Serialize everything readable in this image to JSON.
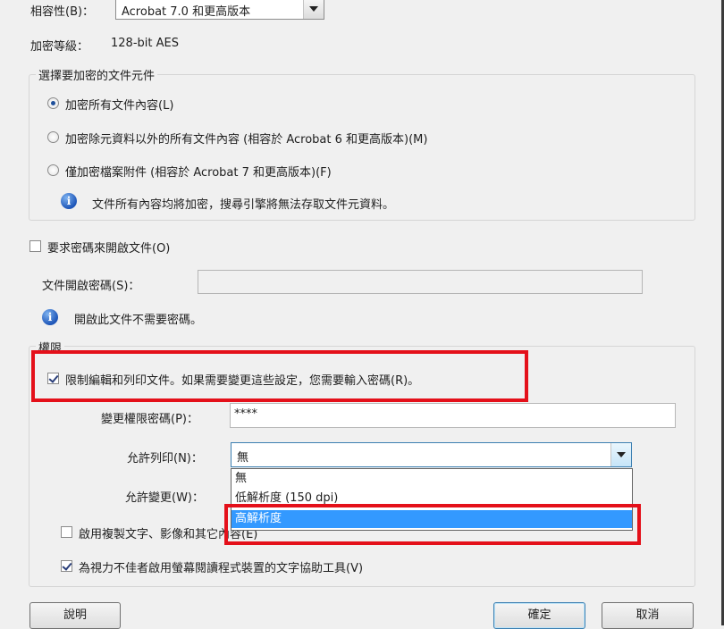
{
  "compatibility": {
    "label": "相容性(B)：",
    "value": "Acrobat 7.0 和更高版本"
  },
  "encryption_level": {
    "label": "加密等級：",
    "value": "128-bit AES"
  },
  "encrypt_group": {
    "legend": "選擇要加密的文件元件",
    "options": [
      {
        "label": "加密所有文件內容(L)",
        "checked": true
      },
      {
        "label": "加密除元資料以外的所有文件內容 (相容於 Acrobat 6 和更高版本)(M)",
        "checked": false
      },
      {
        "label": "僅加密檔案附件 (相容於 Acrobat 7 和更高版本)(F)",
        "checked": false
      }
    ],
    "info_text": "文件所有內容均將加密，搜尋引擎將無法存取文件元資料。"
  },
  "open_password": {
    "checkbox_label": "要求密碼來開啟文件(O)",
    "checked": false,
    "field_label": "文件開啟密碼(S)：",
    "field_value": "",
    "info_text": "開啟此文件不需要密碼。"
  },
  "permissions": {
    "legend": "權限",
    "restrict_label": "限制編輯和列印文件。如果需要變更這些設定，您需要輸入密碼(R)。",
    "restrict_checked": true,
    "change_password_label": "變更權限密碼(P)：",
    "change_password_value": "****",
    "printing_label": "允許列印(N)：",
    "printing_value": "無",
    "printing_options": [
      "無",
      "低解析度 (150 dpi)",
      "高解析度"
    ],
    "printing_highlighted": "高解析度",
    "changes_label": "允許變更(W)：",
    "copy_label": "啟用複製文字、影像和其它內容(E)",
    "copy_checked": false,
    "accessibility_label": "為視力不佳者啟用螢幕閱讀程式裝置的文字協助工具(V)",
    "accessibility_checked": true
  },
  "buttons": {
    "help": "說明",
    "ok": "確定",
    "cancel": "取消"
  },
  "colors": {
    "highlight_box": "#e4101a",
    "selection": "#3399ff",
    "info_icon": "#1e56b8"
  }
}
